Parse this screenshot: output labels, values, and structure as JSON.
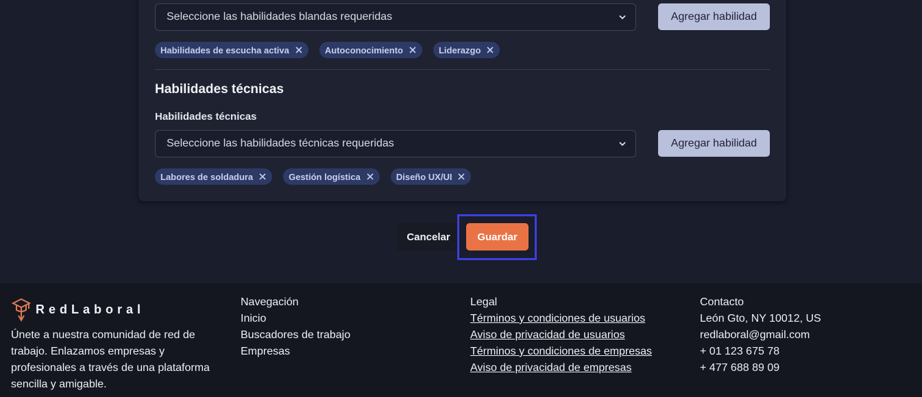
{
  "soft_skills": {
    "select_placeholder": "Seleccione las habilidades blandas requeridas",
    "add_button": "Agregar habilidad",
    "chips": [
      "Habilidades de escucha activa",
      "Autoconocimiento",
      "Liderazgo"
    ]
  },
  "tech_skills": {
    "section_title": "Habilidades técnicas",
    "field_label": "Habilidades técnicas",
    "select_placeholder": "Seleccione las habilidades técnicas requeridas",
    "add_button": "Agregar habilidad",
    "chips": [
      "Labores de soldadura",
      "Gestión logística",
      "Diseño UX/UI"
    ]
  },
  "actions": {
    "cancel_label": "Cancelar",
    "save_label": "Guardar"
  },
  "footer": {
    "brand": "RedLaboral",
    "about": "Únete a nuestra comunidad de red de trabajo. Enlazamos empresas y profesionales a través de una plataforma sencilla y amigable.",
    "navigation": {
      "title": "Navegación",
      "links": [
        "Inicio",
        "Buscadores de trabajo",
        "Empresas"
      ]
    },
    "legal": {
      "title": "Legal",
      "links": [
        "Términos y condiciones de usuarios",
        "Aviso de privacidad de usuarios",
        "Términos y condiciones de empresas",
        "Aviso de privacidad de empresas"
      ]
    },
    "contact": {
      "title": "Contacto",
      "address": "León Gto, NY 10012, US",
      "email": "redlaboral@gmail.com",
      "phone1": "+ 01 123 675 78",
      "phone2": "+ 477 688 89 09"
    }
  },
  "colors": {
    "accent": "#ea7346",
    "focus": "#3d3fe0",
    "chip_bg": "#2d3a66"
  }
}
